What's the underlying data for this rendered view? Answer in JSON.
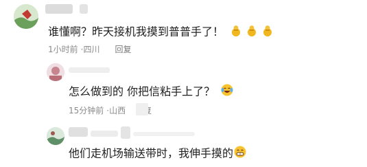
{
  "comments": [
    {
      "text": "谁懂啊？昨天接机我摸到普普手了！",
      "emojis": [
        "gold-gourd-icon",
        "gold-gourd-icon",
        "gold-gourd-icon"
      ],
      "time": "1小时前",
      "location": "四川",
      "reply_label": "回复"
    },
    {
      "text": "怎么做到的 你把信粘手上了？",
      "emojis": [
        "laughing-crying-emoji-icon"
      ],
      "time": "15分钟前",
      "location": "山西",
      "reply_label": "回复"
    },
    {
      "text": "他们走机场输送带时，我伸手摸的",
      "emojis": [
        "grinning-emoji-icon"
      ]
    }
  ],
  "colors": {
    "text": "#1f1f1f",
    "meta": "#8a8a8a",
    "gold": "#f0b81e"
  }
}
